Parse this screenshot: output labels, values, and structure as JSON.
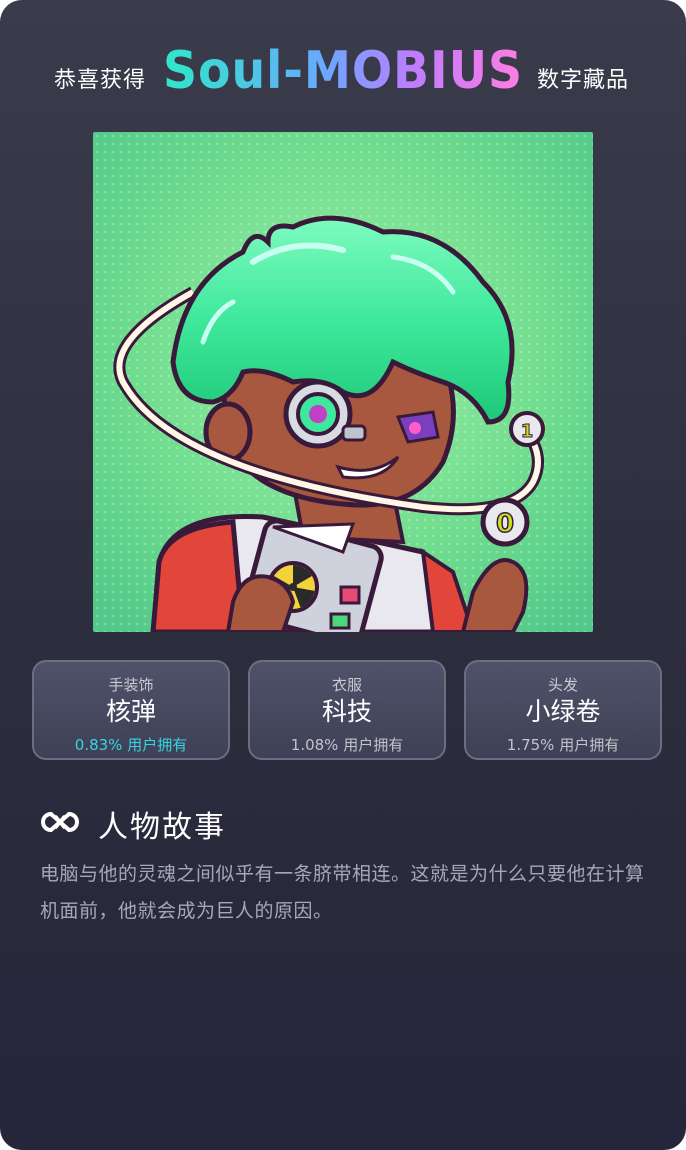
{
  "header": {
    "prefix": "恭喜获得",
    "logo_text": "Soul-MOBIUS",
    "suffix": "数字藏品"
  },
  "traits": [
    {
      "category": "手装饰",
      "value": "核弹",
      "ownership": "0.83% 用户拥有",
      "highlight": true
    },
    {
      "category": "衣服",
      "value": "科技",
      "ownership": "1.08% 用户拥有",
      "highlight": false
    },
    {
      "category": "头发",
      "value": "小绿卷",
      "ownership": "1.75% 用户拥有",
      "highlight": false
    }
  ],
  "story": {
    "title": "人物故事",
    "text": "电脑与他的灵魂之间似乎有一条脐带相连。这就是为什么只要他在计算机面前，他就会成为巨人的原因。"
  },
  "colors": {
    "background": "#2c2d3d",
    "art_background": "#5fcf8e",
    "hair": "#3fe89c",
    "highlight": "#36d4df",
    "logo_gradient": [
      "#2ee8c8",
      "#6aa8ff",
      "#c07cff",
      "#ff7de0"
    ]
  },
  "icons": {
    "story": "infinity-x-icon",
    "logo_o": "infinity-icon"
  }
}
